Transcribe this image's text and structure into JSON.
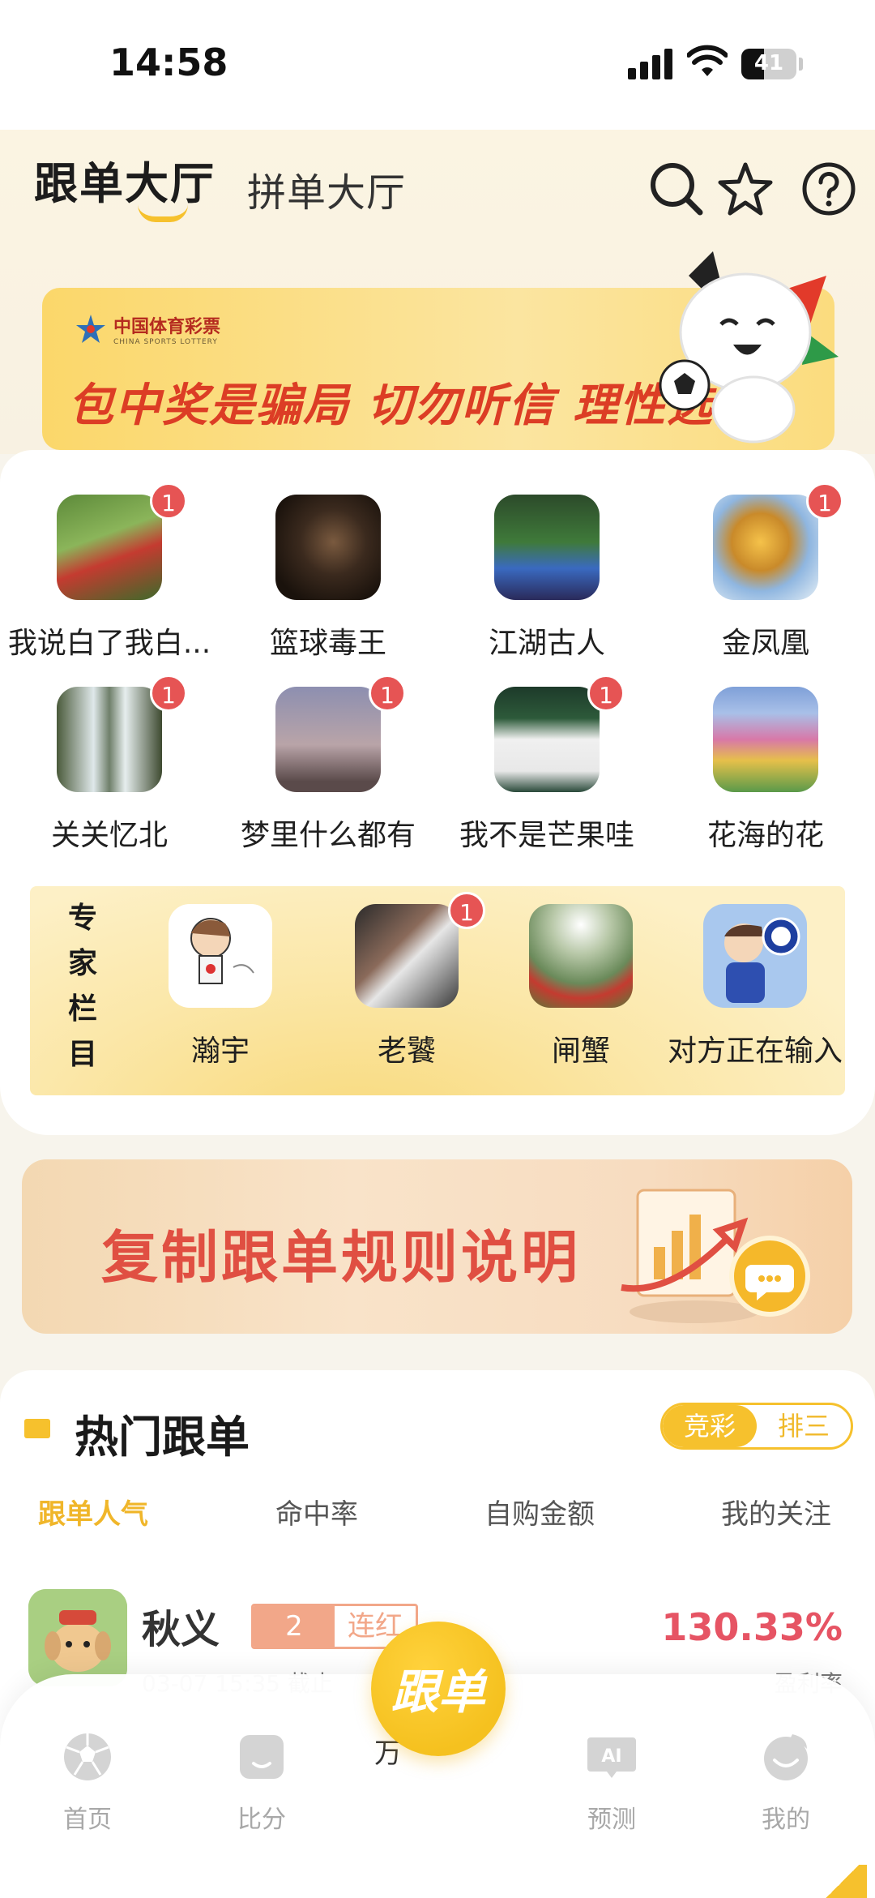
{
  "status_bar": {
    "time": "14:58",
    "battery": "41",
    "battery_level": 0.41
  },
  "header": {
    "tab_active": "跟单大厅",
    "tab_inactive": "拼单大厅",
    "icons": [
      "search-icon",
      "star-icon",
      "help-icon"
    ]
  },
  "banner_top": {
    "logo_cn": "中国体育彩票",
    "logo_en": "CHINA SPORTS LOTTERY",
    "slogan": "包中奖是骗局  切勿听信  理性选择"
  },
  "experts": [
    {
      "name": "我说白了我白...",
      "badge": "1"
    },
    {
      "name": "篮球毒王",
      "badge": ""
    },
    {
      "name": "江湖古人",
      "badge": ""
    },
    {
      "name": "金凤凰",
      "badge": "1"
    },
    {
      "name": "关关忆北",
      "badge": "1"
    },
    {
      "name": "梦里什么都有",
      "badge": "1"
    },
    {
      "name": "我不是芒果哇",
      "badge": "1"
    },
    {
      "name": "花海的花",
      "badge": ""
    }
  ],
  "expert_column": {
    "title": "专家栏目",
    "items": [
      {
        "name": "瀚宇",
        "badge": ""
      },
      {
        "name": "老饕",
        "badge": "1"
      },
      {
        "name": "闸蟹",
        "badge": ""
      },
      {
        "name": "对方正在输入",
        "badge": ""
      }
    ]
  },
  "rules_banner": {
    "text": "复制跟单规则说明"
  },
  "hot": {
    "title": "热门跟单",
    "segment": [
      "竞彩",
      "排三"
    ],
    "sort_tabs": [
      "跟单人气",
      "命中率",
      "自购金额",
      "我的关注"
    ],
    "rows": [
      {
        "name": "秋义",
        "streak_num": "2",
        "streak_label": "连红",
        "rate": "130.33%",
        "deadline": "03-07 15:35 截止",
        "rate_label": "盈利率"
      }
    ]
  },
  "bottom_nav": {
    "items": [
      "首页",
      "比分",
      "预测",
      "我的"
    ],
    "center": "跟单",
    "partial_text": "万"
  },
  "colors": {
    "accent": "#F6C12D",
    "red": "#E65454",
    "rate": "#E65464"
  }
}
